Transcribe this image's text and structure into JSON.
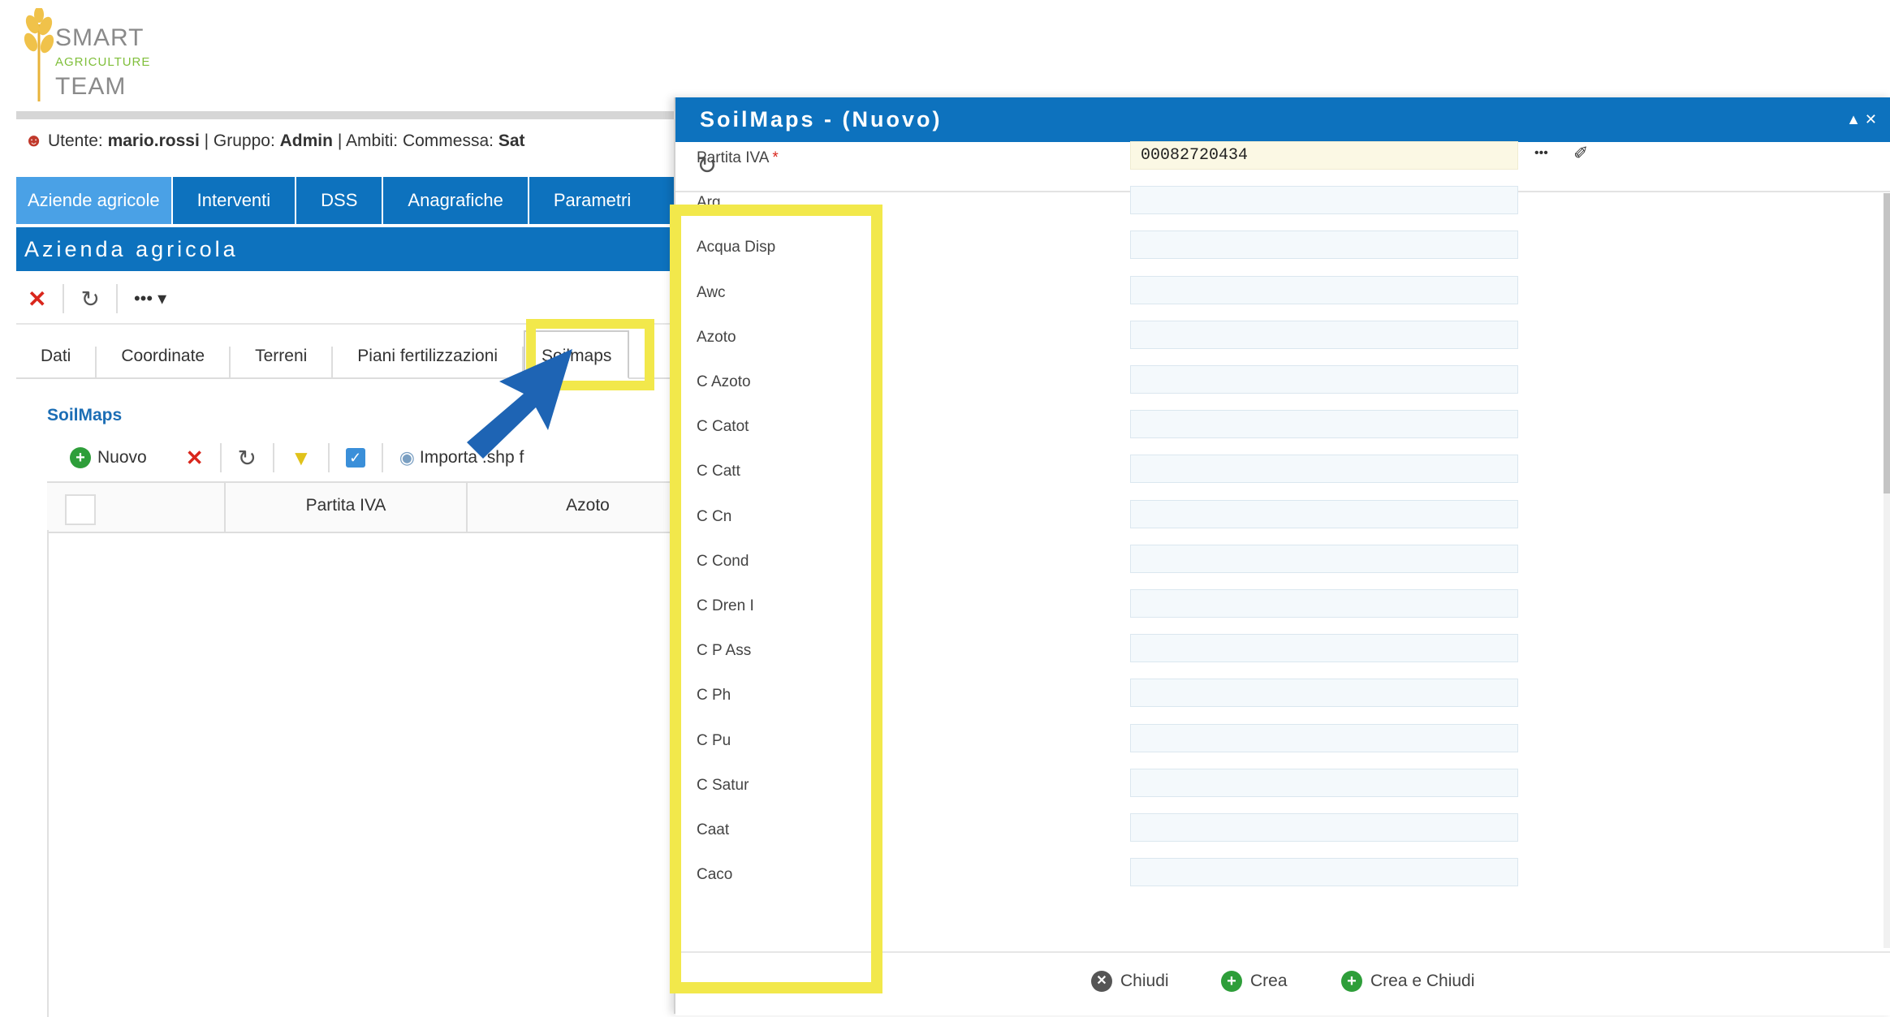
{
  "logo": {
    "line1": "SMART",
    "line2": "AGRICULTURE",
    "line3": "TEAM"
  },
  "user_bar": {
    "user_label": "Utente:",
    "user": "mario.rossi",
    "group_label": "| Gruppo:",
    "group": "Admin",
    "scope_label": "| Ambiti: Commessa:",
    "scope": "Sat"
  },
  "nav": {
    "items": [
      "Aziende agricole",
      "Interventi",
      "DSS",
      "Anagrafiche",
      "Parametri"
    ]
  },
  "section_title": "Azienda agricola",
  "tabs": [
    "Dati",
    "Coordinate",
    "Terreni",
    "Piani fertilizzazioni",
    "Soilmaps"
  ],
  "soilmaps": {
    "label": "SoilMaps",
    "new_label": "Nuovo",
    "import_label": "Importa .shp f",
    "columns": [
      "Partita IVA",
      "Azoto"
    ]
  },
  "modal": {
    "title": "SoilMaps - (Nuovo)",
    "fields": [
      {
        "label": "Partita IVA",
        "required": "*",
        "value": "00082720434"
      },
      {
        "label": "Arg",
        "value": ""
      },
      {
        "label": "Acqua Disp",
        "value": ""
      },
      {
        "label": "Awc",
        "value": ""
      },
      {
        "label": "Azoto",
        "value": ""
      },
      {
        "label": "C Azoto",
        "value": ""
      },
      {
        "label": "C Catot",
        "value": ""
      },
      {
        "label": "C Catt",
        "value": ""
      },
      {
        "label": "C Cn",
        "value": ""
      },
      {
        "label": "C Cond",
        "value": ""
      },
      {
        "label": "C Dren I",
        "value": ""
      },
      {
        "label": "C P Ass",
        "value": ""
      },
      {
        "label": "C Ph",
        "value": ""
      },
      {
        "label": "C Pu",
        "value": ""
      },
      {
        "label": "C Satur",
        "value": ""
      },
      {
        "label": "Caat",
        "value": ""
      },
      {
        "label": "Caco",
        "value": ""
      }
    ],
    "footer": {
      "close": "Chiudi",
      "create": "Crea",
      "create_close": "Crea e Chiudi"
    }
  },
  "colors": {
    "accent": "#0d72be",
    "highlight": "#f2e84b",
    "nav_active": "#4aa1e6"
  }
}
